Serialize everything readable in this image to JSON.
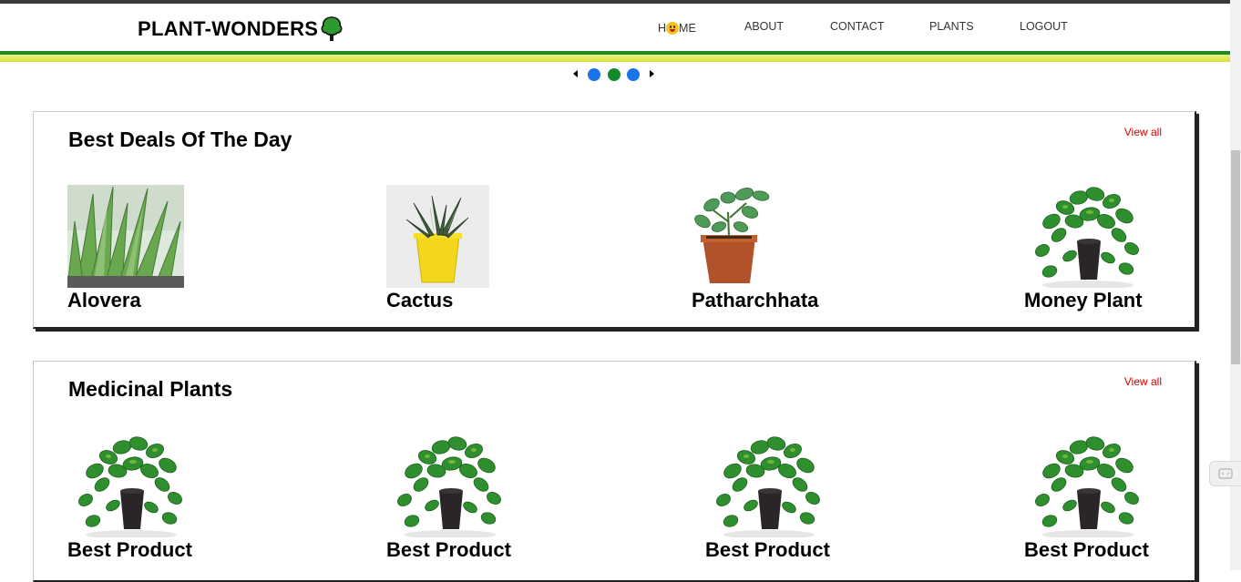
{
  "brand": {
    "name": "PLANT-WONDERS",
    "logo_icon": "tree-icon",
    "accent_green": "#1f8a1f",
    "accent_yellow": "#d8e23a"
  },
  "nav": {
    "home": {
      "prefix": "H",
      "suffix": "ME",
      "emoji": "grinning-face-icon"
    },
    "about": "ABOUT",
    "contact": "CONTACT",
    "plants": "PLANTS",
    "logout": "LOGOUT"
  },
  "carousel": {
    "slides": 3,
    "active_index": 1,
    "dot_color": "#1a73e8",
    "active_dot_color": "#138a2e"
  },
  "sections": [
    {
      "title": "Best Deals Of The Day",
      "view_all": "View all",
      "products": [
        {
          "name": "Alovera",
          "image": "aloe-vera-photo"
        },
        {
          "name": "Cactus",
          "image": "snake-plant-yellow-pot-photo"
        },
        {
          "name": "Patharchhata",
          "image": "patharchatta-terracotta-pot-photo"
        },
        {
          "name": "Money Plant",
          "image": "money-plant-photo"
        }
      ]
    },
    {
      "title": "Medicinal Plants",
      "view_all": "View all",
      "products": [
        {
          "name": "Best Product",
          "image": "money-plant-photo"
        },
        {
          "name": "Best Product",
          "image": "money-plant-photo"
        },
        {
          "name": "Best Product",
          "image": "money-plant-photo"
        },
        {
          "name": "Best Product",
          "image": "money-plant-photo"
        }
      ]
    }
  ],
  "colors": {
    "view_all": "#d40000"
  }
}
